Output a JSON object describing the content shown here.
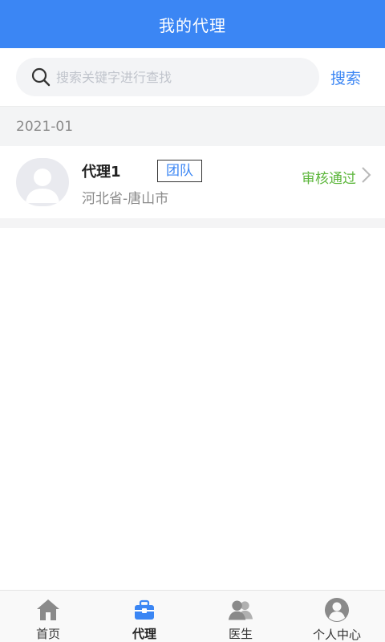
{
  "header": {
    "title": "我的代理"
  },
  "search": {
    "placeholder": "搜索关键字进行查找",
    "value": "",
    "button_label": "搜索"
  },
  "groups": [
    {
      "month": "2021-01",
      "items": [
        {
          "name": "代理1",
          "badge": "团队",
          "region": "河北省-唐山市",
          "status": "审核通过"
        }
      ]
    }
  ],
  "tabs": [
    {
      "label": "首页",
      "icon": "home-icon"
    },
    {
      "label": "代理",
      "icon": "briefcase-icon",
      "active": true
    },
    {
      "label": "医生",
      "icon": "users-icon"
    },
    {
      "label": "个人中心",
      "icon": "user-circle-icon"
    }
  ],
  "colors": {
    "primary": "#3b86f4",
    "status_ok": "#5cb63b",
    "tab_icon": "#8a8a8a"
  }
}
